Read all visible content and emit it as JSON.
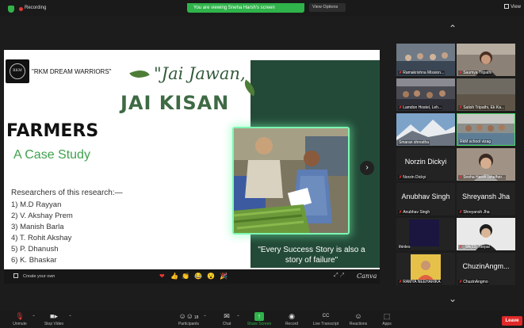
{
  "topbar": {
    "recording_label": "Recording",
    "share_banner": "You are viewing Sneha Harsh's screen",
    "view_options": "View Options",
    "view_label": "View"
  },
  "slide": {
    "team_name": "\"RKM DREAM WARRIORS\"",
    "logo_text": "RKM",
    "title_italic": "\"Jai Jawan,",
    "title_bold": "JAI KISAN",
    "heading": "FARMERS",
    "subheading": "A Case Study",
    "researchers_title": "Researchers of this research:—",
    "researchers": [
      "1) M.D Rayyan",
      "2) V. Akshay Prem",
      "3) Manish Barla",
      "4) T. Rohit Akshay",
      "5) P. Dhanush",
      "6) K. Bhaskar"
    ],
    "quote": "\"Every Success Story is also a story of failure\"",
    "colors": {
      "accent_green": "#3fa14d",
      "panel": "#234a38",
      "glow": "#7cf7b1"
    }
  },
  "canva_bar": {
    "create_label": "Create your own",
    "logo": "Canva",
    "reactions": [
      "❤",
      "👍",
      "👏",
      "😂",
      "😮",
      "🎉"
    ]
  },
  "gallery": {
    "tiles": [
      {
        "name": "Ramakrishna Mission..."
      },
      {
        "name": "Saumya Tripathi"
      },
      {
        "name": "Lamdon Hostel, Leh..."
      },
      {
        "name": "Satish Tripathi, Ek Ka..."
      },
      {
        "name": "Smaran shrestha"
      },
      {
        "name": "RkM school vizag"
      },
      {
        "name": "Norzin Dickyi",
        "big": "Norzin Dickyi"
      },
      {
        "name": "Sneha Harsh (she/her..."
      },
      {
        "name": "Anubhav Singh",
        "big": "Anubhav Singh"
      },
      {
        "name": "Shreyansh Jha",
        "big": "Shreyansh Jha"
      },
      {
        "name": "thinles"
      },
      {
        "name": "_9A(23) Tsepal"
      },
      {
        "name": "RAMYA NEEHARIKA"
      },
      {
        "name": "ChuzinAngmo",
        "big": "ChuzinAngm..."
      }
    ]
  },
  "toolbar": {
    "unmute": "Unmute",
    "stop_video": "Stop Video",
    "participants": "Participants",
    "participants_count": "18",
    "chat": "Chat",
    "share_screen": "Share Screen",
    "record": "Record",
    "live_transcript": "Live Transcript",
    "reactions": "Reactions",
    "apps": "Apps",
    "leave": "Leave"
  }
}
